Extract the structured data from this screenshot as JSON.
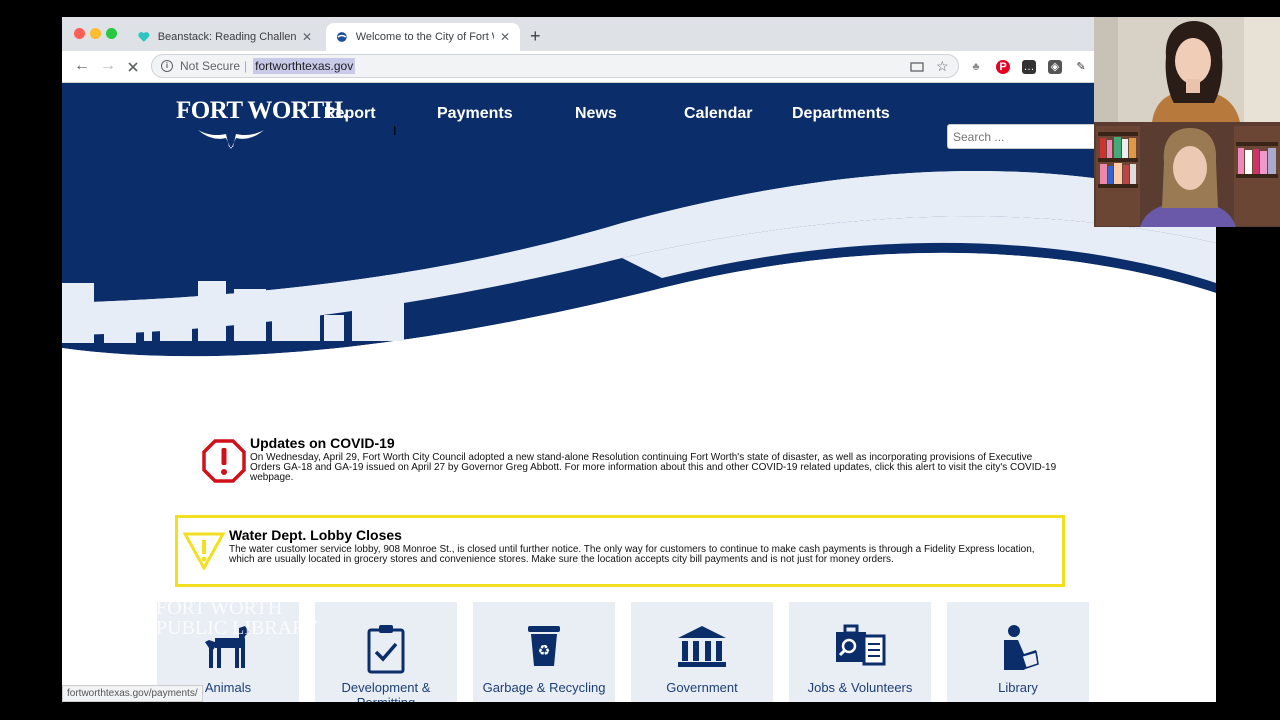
{
  "browser": {
    "tabs": [
      {
        "title": "Beanstack: Reading Challenge",
        "icon": "heart-icon"
      },
      {
        "title": "Welcome to the City of Fort Worth",
        "icon": "fort-worth-icon",
        "active": true
      }
    ],
    "security_label": "Not Secure",
    "url": "fortworthtexas.gov",
    "status_url": "fortworthtexas.gov/payments/"
  },
  "site": {
    "logo_text": "FORT WORTH.",
    "nav": [
      "Report",
      "Payments",
      "News",
      "Calendar",
      "Departments"
    ],
    "search_placeholder": "Search ...",
    "colors": {
      "navy": "#0b2e6b",
      "light": "#e7edf6",
      "alert_red": "#d1111a",
      "alert_yellow": "#f2e020"
    }
  },
  "alerts": [
    {
      "title": "Updates on COVID-19",
      "text": "On Wednesday, April 29, Fort Worth City Council adopted a new stand-alone Resolution continuing Fort Worth's state of disaster, as well as incorporating provisions of Executive Orders GA-18 and GA-19 issued on April 27 by Governor Greg Abbott. For more information about this and other COVID-19 related updates, click this alert to visit the city's COVID-19 webpage.",
      "icon": "alert-octagon-icon"
    },
    {
      "title": "Water Dept. Lobby Closes",
      "text": "The water customer service lobby, 908 Monroe St., is closed until further notice. The only way for customers to continue to make cash payments is through a Fidelity Express location, which are usually located in grocery stores and convenience stores. Make sure the location accepts city bill payments and is not just for money orders.",
      "icon": "warning-triangle-icon"
    }
  ],
  "watermark": {
    "line1": "FORT WORTH",
    "line2": "PUBLIC LIBRARY"
  },
  "tiles": [
    {
      "label": "Animals",
      "icon": "dog-icon"
    },
    {
      "label": "Development & Permitting",
      "icon": "clipboard-check-icon"
    },
    {
      "label": "Garbage & Recycling",
      "icon": "recycle-bin-icon"
    },
    {
      "label": "Government",
      "icon": "building-columns-icon"
    },
    {
      "label": "Jobs & Volunteers",
      "icon": "job-search-icon"
    },
    {
      "label": "Library",
      "icon": "reader-icon"
    }
  ]
}
